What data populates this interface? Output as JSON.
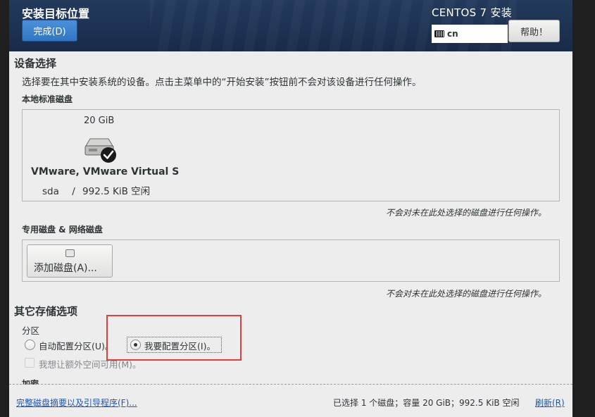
{
  "header": {
    "spoke_title": "安装目标位置",
    "done_label": "完成(D)",
    "product_title": "CENTOS 7 安装",
    "keyboard_layout": "cn",
    "help_label": "帮助！"
  },
  "device_selection": {
    "title": "设备选择",
    "description": "选择要在其中安装系统的设备。点击主菜单中的“开始安装”按钮前不会对该设备进行任何操作。",
    "local_disks_title": "本地标准磁盘",
    "disk": {
      "size": "20 GiB",
      "name": "VMware, VMware Virtual S",
      "device": "sda",
      "separator": "/",
      "free": "992.5 KiB 空闲",
      "selected": true
    },
    "local_note": "不会对未在此处选择的磁盘进行任何操作。",
    "special_disks_title": "专用磁盘 & 网络磁盘",
    "add_disk_label": "添加磁盘(A)...",
    "special_note": "不会对未在此处选择的磁盘进行任何操作。"
  },
  "other_storage": {
    "title": "其它存储选项",
    "partitioning_title": "分区",
    "auto_partition_label": "自动配置分区(U)。",
    "manual_partition_label": "我要配置分区(I)。",
    "partitioning_selected": "manual",
    "extra_space_label": "我想让额外空间可用(M)。",
    "encryption_title": "加密"
  },
  "bottom_bar": {
    "summary_link": "完整磁盘摘要以及引导程序(F)...",
    "status": "已选择 1 个磁盘；容量 20 GiB；992.5 KiB 空闲",
    "refresh_label": "刷新(R)"
  },
  "colors": {
    "header_bg": "#1d3253",
    "done_button": "#3a80cf",
    "highlight_box": "#e53b3b",
    "link": "#1f56b0"
  }
}
